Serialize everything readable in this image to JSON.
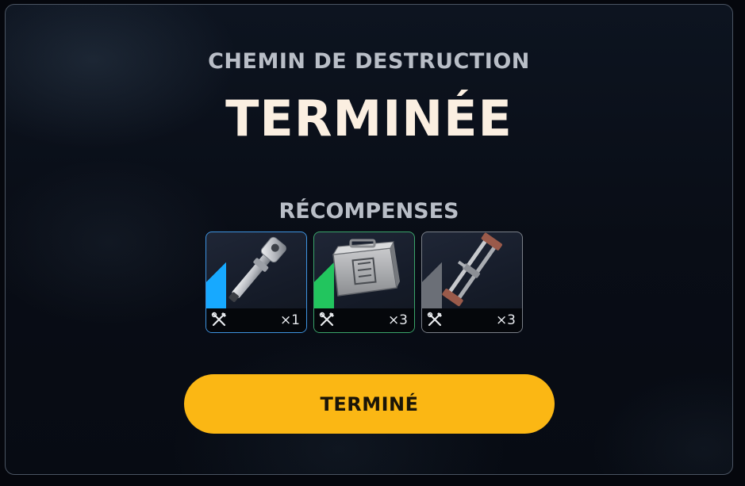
{
  "modal": {
    "subtitle": "CHEMIN DE DESTRUCTION",
    "title": "TERMINÉE",
    "rewards_heading": "RÉCOMPENSES"
  },
  "rewards": [
    {
      "item_icon": "barrel-part-icon",
      "quantity": "×1",
      "rarity_color": "#17a9ff",
      "type_icon": "tools-icon"
    },
    {
      "item_icon": "ammo-crate-icon",
      "quantity": "×3",
      "rarity_color": "#22c55e",
      "type_icon": "tools-icon"
    },
    {
      "item_icon": "rail-frame-icon",
      "quantity": "×3",
      "rarity_color": "#6b6f77",
      "type_icon": "tools-icon"
    }
  ],
  "button": {
    "label": "TERMINÉ",
    "color": "#fbb714"
  }
}
